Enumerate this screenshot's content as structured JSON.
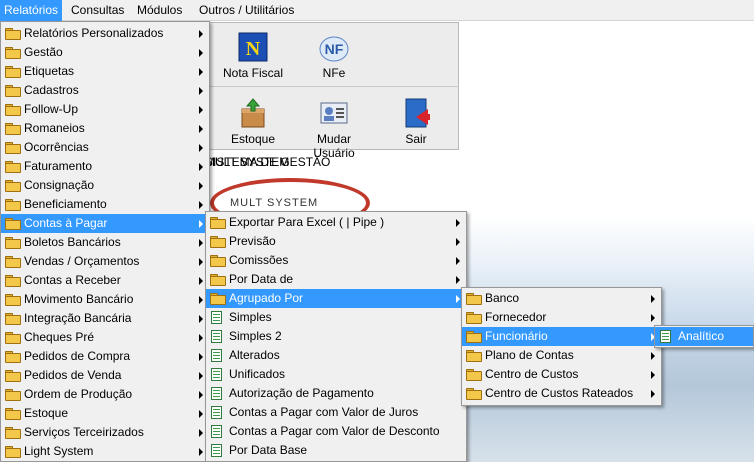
{
  "menubar": {
    "items": [
      "Relatórios",
      "Consultas",
      "Módulos",
      "Outros / Utilitários"
    ]
  },
  "toolbar": {
    "buttons": [
      "Nota Fiscal",
      "NFe",
      "Estoque",
      "Mudar Usuário",
      "Sair"
    ]
  },
  "banner": {
    "logo_text": "MULT SYSTEM",
    "title": "MULT SYSTEM",
    "subtitle": "SISTEMA DE GESTÃO"
  },
  "menu1": {
    "items": [
      "Relatórios Personalizados",
      "Gestão",
      "Etiquetas",
      "Cadastros",
      "Follow-Up",
      "Romaneios",
      "Ocorrências",
      "Faturamento",
      "Consignação",
      "Beneficiamento",
      "Contas à Pagar",
      "Boletos Bancários",
      "Vendas / Orçamentos",
      "Contas a Receber",
      "Movimento Bancário",
      "Integração Bancária",
      "Cheques Pré",
      "Pedidos de Compra",
      "Pedidos de Venda",
      "Ordem de Produção",
      "Estoque",
      "Serviços Terceirizados",
      "Light System"
    ]
  },
  "menu2": {
    "items": [
      "Exportar Para Excel ( | Pipe )",
      "Previsão",
      "Comissões",
      "Por Data de",
      "Agrupado Por",
      "Simples",
      "Simples 2",
      "Alterados",
      "Unificados",
      "Autorização de Pagamento",
      "Contas a Pagar com Valor de Juros",
      "Contas a Pagar com Valor de Desconto",
      "Por Data Base"
    ]
  },
  "menu3": {
    "items": [
      "Banco",
      "Fornecedor",
      "Funcionário",
      "Plano de Contas",
      "Centro de Custos",
      "Centro de Custos Rateados"
    ]
  },
  "menu4": {
    "items": [
      "Analítico"
    ]
  },
  "colors": {
    "highlight": "#3399ff",
    "menu_bg": "#f0f0f0"
  }
}
